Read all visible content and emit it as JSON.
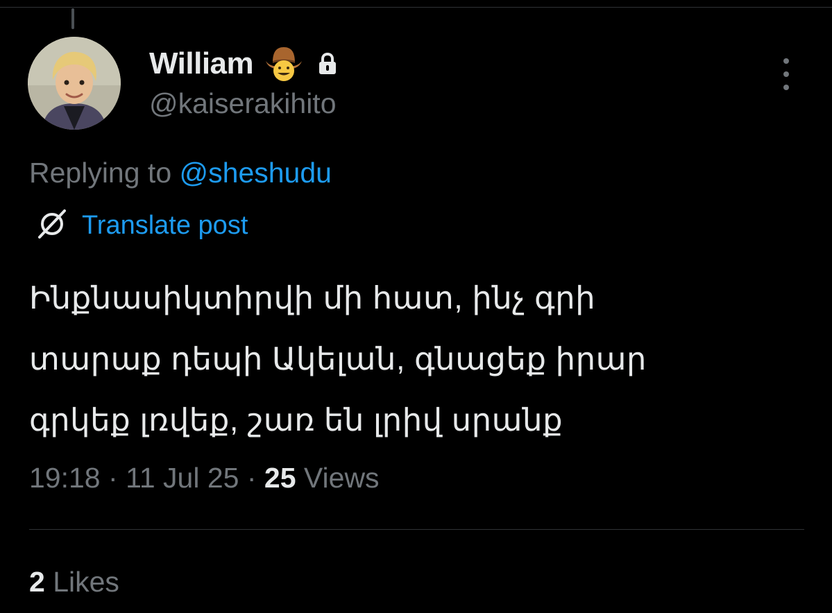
{
  "author": {
    "display_name": "William",
    "handle": "@kaiserakihito",
    "badge_emoji": "cowboy-hat-face-emoji",
    "protected_icon": "lock-icon",
    "avatar": "avatar-photo"
  },
  "reply": {
    "prefix": "Replying to",
    "mention": "@sheshudu"
  },
  "translate": {
    "icon": "translate-globe-icon",
    "label": "Translate post"
  },
  "post": {
    "lines": [
      "Ինքնասիկտիրվի մի հատ, ինչ գրի",
      "տարաք դեպի Ակելան, գնացեք իրար",
      "գրկեք լռվեք, շառ են լրիվ սրանք"
    ]
  },
  "meta": {
    "time": "19:18",
    "separator": "·",
    "date": "11 Jul 25",
    "views_count": "25",
    "views_label": "Views"
  },
  "stats": {
    "likes_count": "2",
    "likes_label": "Likes"
  },
  "more_icon": "more-vertical-icon",
  "colors": {
    "background": "#000000",
    "text_primary": "#e7e9ea",
    "text_secondary": "#71767b",
    "link": "#1d9bf0",
    "divider": "#2f3336"
  }
}
